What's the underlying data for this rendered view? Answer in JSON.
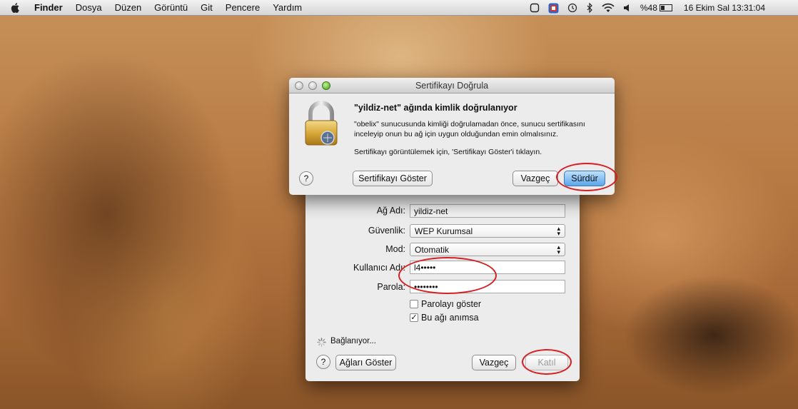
{
  "menubar": {
    "app_name": "Finder",
    "items": [
      "Dosya",
      "Düzen",
      "Görüntü",
      "Git",
      "Pencere",
      "Yardım"
    ],
    "battery": "%48",
    "datetime": "16 Ekim Sal 13:31:04"
  },
  "cert_dialog": {
    "title": "Sertifikayı Doğrula",
    "heading": "\"yildiz-net\" ağında kimlik doğrulanıyor",
    "body": "\"obelix\" sunucusunda kimliği doğrulamadan önce, sunucu sertifikasını inceleyip onun bu ağ için uygun olduğundan emin olmalısınız.",
    "hint": "Sertifikayı görüntülemek için, 'Sertifikayı Göster'i tıklayın.",
    "help_label": "?",
    "show_cert_button": "Sertifikayı Göster",
    "cancel_button": "Vazgeç",
    "continue_button": "Sürdür"
  },
  "network_dialog": {
    "network_name_label": "Ağ Adı:",
    "network_name_value": "yildiz-net",
    "security_label": "Güvenlik:",
    "security_value": "WEP Kurumsal",
    "mode_label": "Mod:",
    "mode_value": "Otomatik",
    "username_label": "Kullanıcı Adı:",
    "username_value": "l4•••••",
    "password_label": "Parola:",
    "password_value": "••••••••",
    "show_password_label": "Parolayı göster",
    "show_password_checked": false,
    "remember_label": "Bu ağı anımsa",
    "remember_checked": true,
    "status": "Bağlanıyor...",
    "help_label": "?",
    "show_networks_button": "Ağları Göster",
    "cancel_button": "Vazgeç",
    "join_button": "Katıl"
  },
  "colors": {
    "annotation_red": "#d61f24",
    "default_button_blue": "#5aa6ea"
  }
}
